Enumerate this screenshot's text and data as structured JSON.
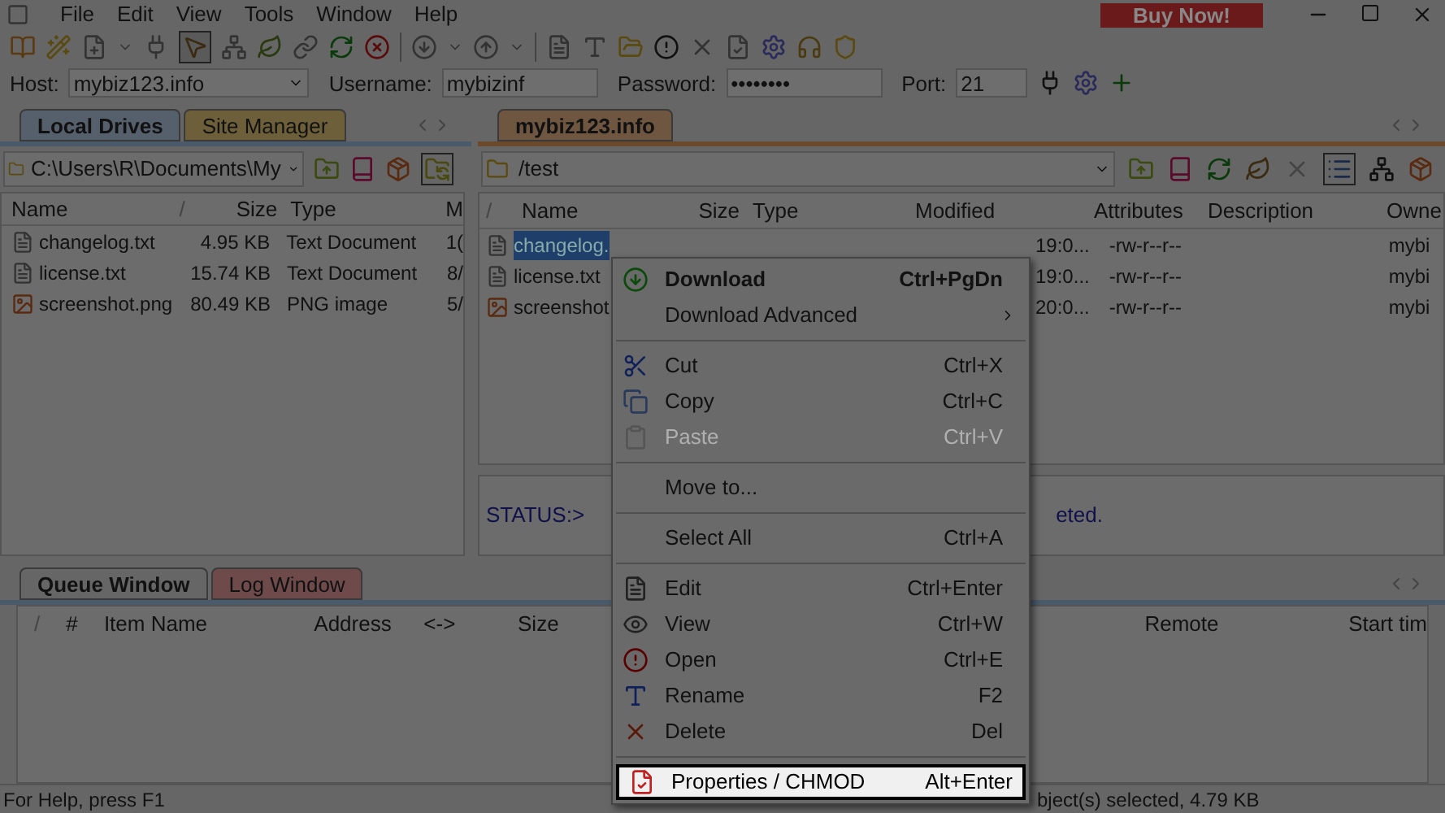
{
  "menu_bar": [
    "File",
    "Edit",
    "View",
    "Tools",
    "Window",
    "Help"
  ],
  "buy_button": "Buy Now!",
  "connection": {
    "host_label": "Host:",
    "host": "mybiz123.info",
    "username_label": "Username:",
    "username": "mybizinf",
    "password_label": "Password:",
    "password": "••••••••",
    "port_label": "Port:",
    "port": "21"
  },
  "local": {
    "tabs": [
      {
        "label": "Local Drives",
        "selected": true
      },
      {
        "label": "Site Manager",
        "selected": false
      }
    ],
    "path": "C:\\Users\\R\\Documents\\My",
    "columns": [
      "Name",
      "/",
      "Size",
      "Type",
      "M"
    ],
    "rows": [
      {
        "kind": "text",
        "name": "changelog.txt",
        "size": "4.95 KB",
        "type": "Text Document",
        "modified": "1("
      },
      {
        "kind": "text",
        "name": "license.txt",
        "size": "15.74 KB",
        "type": "Text Document",
        "modified": "8/"
      },
      {
        "kind": "image",
        "name": "screenshot.png",
        "size": "80.49 KB",
        "type": "PNG image",
        "modified": "5/"
      }
    ]
  },
  "remote": {
    "tab": "mybiz123.info",
    "path": "/test",
    "columns": [
      "/",
      "Name",
      "Size",
      "Type",
      "Modified",
      "Attributes",
      "Description",
      "Owne"
    ],
    "rows": [
      {
        "kind": "text",
        "name": "changelog.",
        "selected": true,
        "modified": "19:0...",
        "attributes": "-rw-r--r--",
        "owner": "mybi"
      },
      {
        "kind": "text",
        "name": "license.txt",
        "selected": false,
        "modified": "19:0...",
        "attributes": "-rw-r--r--",
        "owner": "mybi"
      },
      {
        "kind": "image",
        "name": "screenshot",
        "selected": false,
        "modified": "20:0...",
        "attributes": "-rw-r--r--",
        "owner": "mybi"
      }
    ],
    "log": [
      "STATUS:>",
      "eted."
    ]
  },
  "queue": {
    "tabs": [
      {
        "label": "Queue Window",
        "selected": true
      },
      {
        "label": "Log Window",
        "selected": false
      }
    ],
    "columns": [
      "/",
      "#",
      "Item Name",
      "Address",
      "<->",
      "Size",
      "Remote",
      "Start tim"
    ]
  },
  "status_bar": [
    "For Help, press F1",
    "bject(s) selected, 4.79 KB"
  ],
  "context_menu": [
    {
      "kind": "item",
      "label": "Download",
      "shortcut": "Ctrl+PgDn",
      "bold": true,
      "disabled": false,
      "submenu": false,
      "highlighted": false
    },
    {
      "kind": "item",
      "label": "Download Advanced",
      "bold": false,
      "disabled": false,
      "submenu": true,
      "highlighted": false
    },
    {
      "kind": "separator"
    },
    {
      "kind": "item",
      "label": "Cut",
      "shortcut": "Ctrl+X",
      "bold": false,
      "disabled": false,
      "submenu": false,
      "highlighted": false
    },
    {
      "kind": "item",
      "label": "Copy",
      "shortcut": "Ctrl+C",
      "bold": false,
      "disabled": false,
      "submenu": false,
      "highlighted": false
    },
    {
      "kind": "item",
      "label": "Paste",
      "shortcut": "Ctrl+V",
      "bold": false,
      "disabled": true,
      "submenu": false,
      "highlighted": false
    },
    {
      "kind": "separator"
    },
    {
      "kind": "item",
      "label": "Move to...",
      "bold": false,
      "disabled": false,
      "submenu": false,
      "highlighted": false
    },
    {
      "kind": "separator"
    },
    {
      "kind": "item",
      "label": "Select All",
      "shortcut": "Ctrl+A",
      "bold": false,
      "disabled": false,
      "submenu": false,
      "highlighted": false
    },
    {
      "kind": "separator"
    },
    {
      "kind": "item",
      "label": "Edit",
      "shortcut": "Ctrl+Enter",
      "bold": false,
      "disabled": false,
      "submenu": false,
      "highlighted": false
    },
    {
      "kind": "item",
      "label": "View",
      "shortcut": "Ctrl+W",
      "bold": false,
      "disabled": false,
      "submenu": false,
      "highlighted": false
    },
    {
      "kind": "item",
      "label": "Open",
      "shortcut": "Ctrl+E",
      "bold": false,
      "disabled": false,
      "submenu": false,
      "highlighted": false
    },
    {
      "kind": "item",
      "label": "Rename",
      "shortcut": "F2",
      "bold": false,
      "disabled": false,
      "submenu": false,
      "highlighted": false
    },
    {
      "kind": "item",
      "label": "Delete",
      "shortcut": "Del",
      "bold": false,
      "disabled": false,
      "submenu": false,
      "highlighted": false
    },
    {
      "kind": "separator"
    },
    {
      "kind": "item",
      "label": "Properties / CHMOD",
      "shortcut": "Alt+Enter",
      "bold": false,
      "disabled": false,
      "submenu": false,
      "highlighted": true
    }
  ]
}
